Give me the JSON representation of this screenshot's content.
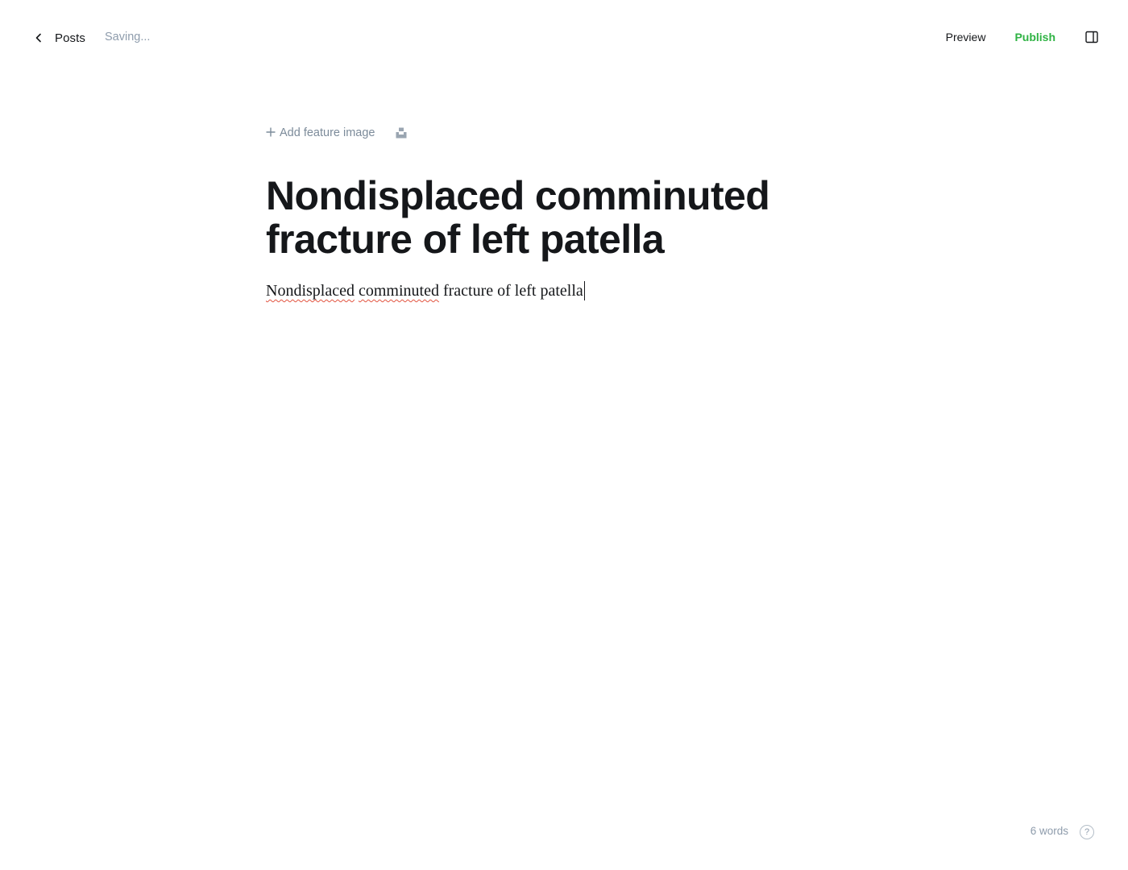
{
  "header": {
    "back_label": "Posts",
    "status": "Saving...",
    "preview_label": "Preview",
    "publish_label": "Publish",
    "publish_color": "#2fb344"
  },
  "editor": {
    "add_feature_label": "Add feature image",
    "title": "Nondisplaced comminuted fracture of left patella",
    "body_words": [
      {
        "text": "Nondisplaced",
        "misspelled": true
      },
      {
        "text": "comminuted",
        "misspelled": true
      },
      {
        "text": "fracture of left patella",
        "misspelled": false
      }
    ]
  },
  "footer": {
    "word_count": "6 words",
    "help_symbol": "?"
  },
  "icons": {
    "back": "chevron-left-icon",
    "sidebar": "sidebar-toggle-icon",
    "add": "plus-icon",
    "unsplash": "unsplash-icon",
    "help": "help-icon"
  }
}
